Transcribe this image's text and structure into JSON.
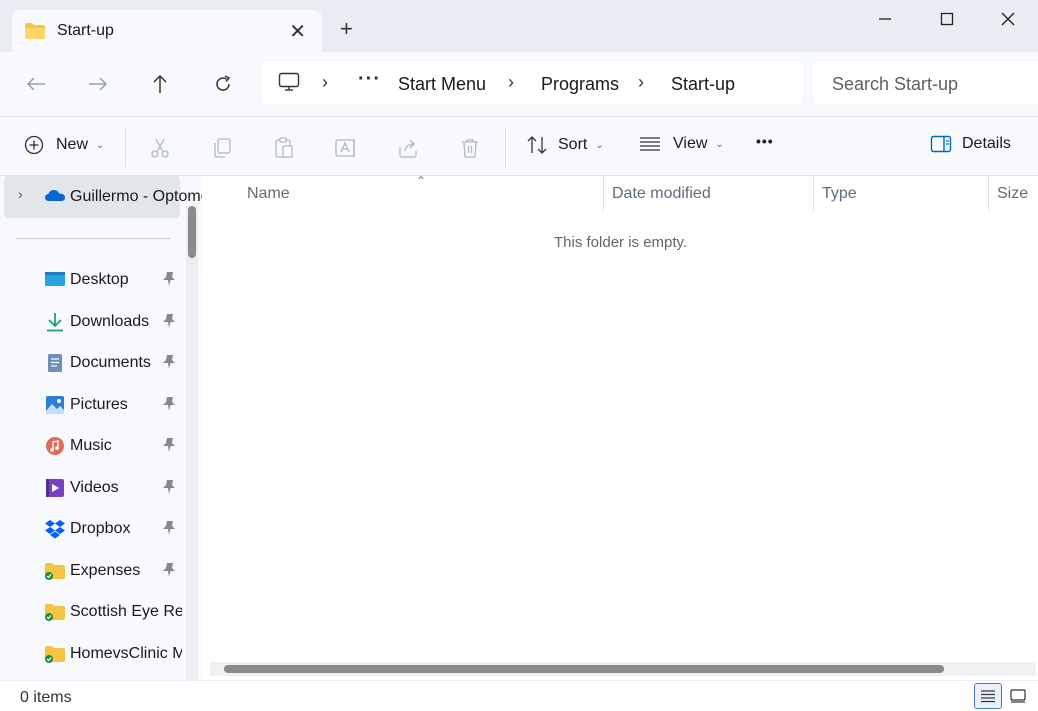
{
  "tab": {
    "title": "Start-up",
    "close": "✕",
    "new_tab": "+"
  },
  "window": {
    "minimize": "—",
    "maximize": "☐",
    "close": "✕"
  },
  "address": {
    "overflow": "···",
    "separator": "›",
    "crumbs": [
      "Start Menu",
      "Programs",
      "Start-up"
    ]
  },
  "search": {
    "placeholder": "Search Start-up"
  },
  "toolbar": {
    "new_label": "New",
    "sort_label": "Sort",
    "view_label": "View",
    "more_label": "•••",
    "details_label": "Details"
  },
  "sidebar": {
    "top_item": "Guillermo - Optometry",
    "items": [
      {
        "label": "Desktop",
        "icon": "desktop-icon",
        "pinned": true
      },
      {
        "label": "Downloads",
        "icon": "download-icon",
        "pinned": true
      },
      {
        "label": "Documents",
        "icon": "documents-icon",
        "pinned": true
      },
      {
        "label": "Pictures",
        "icon": "pictures-icon",
        "pinned": true
      },
      {
        "label": "Music",
        "icon": "music-icon",
        "pinned": true
      },
      {
        "label": "Videos",
        "icon": "videos-icon",
        "pinned": true
      },
      {
        "label": "Dropbox",
        "icon": "dropbox-icon",
        "pinned": true
      },
      {
        "label": "Expenses",
        "icon": "folder-synced-icon",
        "pinned": true
      },
      {
        "label": "Scottish Eye Research",
        "icon": "folder-synced-icon",
        "pinned": false
      },
      {
        "label": "HomevsClinic Monitoring",
        "icon": "folder-synced-icon",
        "pinned": false
      }
    ]
  },
  "columns": {
    "name": "Name",
    "date_modified": "Date modified",
    "type": "Type",
    "size": "Size"
  },
  "content": {
    "empty_message": "This folder is empty."
  },
  "status": {
    "item_count": "0 items"
  },
  "colors": {
    "accent": "#0067c0",
    "folder": "#f4c542",
    "onedrive": "#0a64d6"
  }
}
